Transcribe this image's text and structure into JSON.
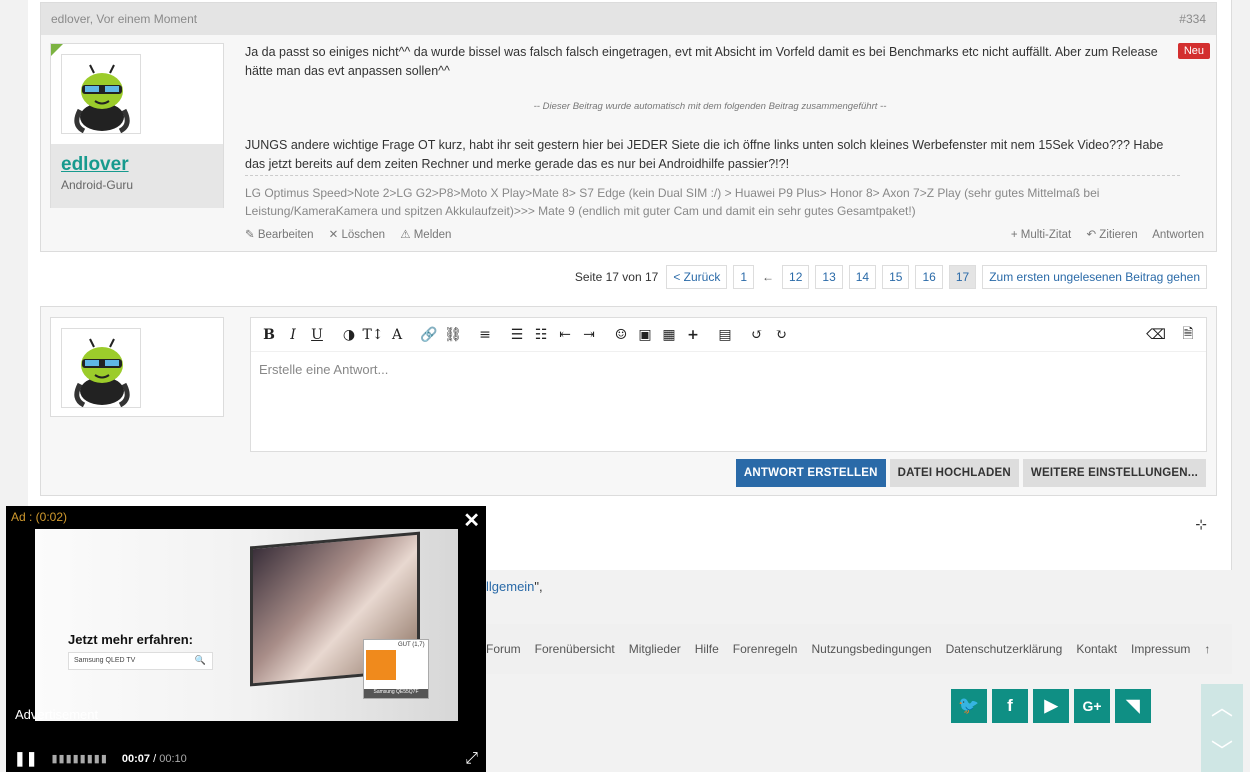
{
  "post": {
    "header_author_time": "edlover, Vor einem Moment",
    "post_number": "#334",
    "badge": "Neu",
    "author_name": "edlover",
    "author_role": "Android-Guru",
    "text1": "Ja da passt so einiges nicht^^ da wurde bissel was falsch falsch eingetragen, evt mit Absicht im Vorfeld damit es bei Benchmarks etc nicht auffällt. Aber zum Release hätte man das evt anpassen sollen^^",
    "merged_notice": "-- Dieser Beitrag wurde automatisch mit dem folgenden Beitrag zusammengeführt --",
    "text2": "JUNGS andere wichtige Frage OT kurz, habt ihr seit gestern hier bei JEDER Siete die ich öffne links unten solch kleines Werbefenster mit nem 15Sek Video??? Habe das jetzt bereits auf dem zeiten Rechner und merke gerade das es nur bei Androidhilfe passier?!?!",
    "signature": "LG Optimus Speed>Note 2>LG G2>P8>Moto X Play>Mate 8> S7 Edge (kein Dual SIM :/) > Huawei P9 Plus> Honor 8> Axon 7>Z Play (sehr gutes Mittelmaß bei Leistung/KameraKamera und spitzen Akkulaufzeit)>>> Mate 9 (endlich mit guter Cam und damit ein sehr gutes Gesamtpaket!)",
    "actions_left": [
      "Bearbeiten",
      "Löschen",
      "Melden"
    ],
    "actions_right": [
      "+ Multi-Zitat",
      "Zitieren",
      "Antworten"
    ]
  },
  "pager": {
    "label": "Seite 17 von 17",
    "prev": "< Zurück",
    "first": "1",
    "gap": "←",
    "pages": [
      "12",
      "13",
      "14",
      "15",
      "16",
      "17"
    ],
    "current": "17",
    "first_unread": "Zum ersten ungelesenen Beitrag gehen"
  },
  "reply": {
    "placeholder": "Erstelle eine Antwort...",
    "submit": "ANTWORT ERSTELLEN",
    "upload": "DATEI HOCHLADEN",
    "more": "WEITERE EINSTELLUNGEN..."
  },
  "category_link": "llgemein",
  "category_suffix": "\",",
  "footer": [
    "Forum",
    "Forenübersicht",
    "Mitglieder",
    "Hilfe",
    "Forenregeln",
    "Nutzungsbedingungen",
    "Datenschutzerklärung",
    "Kontakt",
    "Impressum"
  ],
  "ad": {
    "countdown": "Ad : (0:02)",
    "headline": "Jetzt mehr erfahren:",
    "search_text": "Samsung QLED TV",
    "badge_grade": "GUT (1,7)",
    "badge_model": "Samsung QE55Q7F",
    "label": "Advertisement",
    "time_current": "00:07",
    "time_sep": "/",
    "time_total": "00:10"
  },
  "colors": {
    "accent": "#2a6aa8",
    "teal": "#0f8f84",
    "badge": "#d32f2f"
  }
}
